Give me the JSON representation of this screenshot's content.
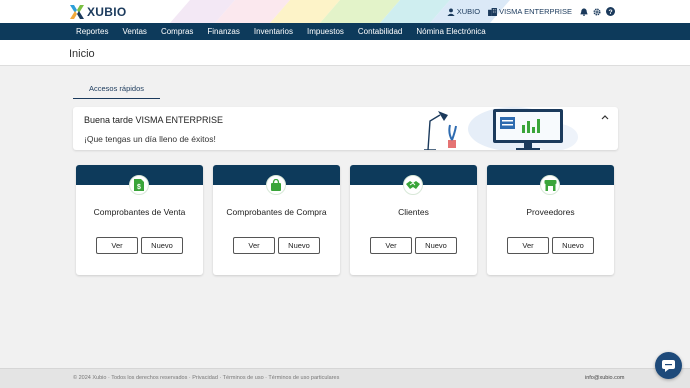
{
  "header": {
    "logo_text": "XUBIO",
    "user_label": "XUBIO",
    "company_label": "VISMA ENTERPRISE",
    "icons": [
      "user-icon",
      "building-icon",
      "bell-icon",
      "gear-icon",
      "help-icon"
    ]
  },
  "nav": {
    "items": [
      "Reportes",
      "Ventas",
      "Compras",
      "Finanzas",
      "Inventarios",
      "Impuestos",
      "Contabilidad",
      "Nómina Electrónica"
    ]
  },
  "page": {
    "title": "Inicio"
  },
  "tabs": {
    "active": "Accesos rápidos"
  },
  "greeting": {
    "title": "Buena tarde VISMA ENTERPRISE",
    "subtitle": "¡Que tengas un día lleno de éxitos!"
  },
  "cards": [
    {
      "title": "Comprobantes de Venta",
      "icon": "invoice-dollar-icon",
      "view_label": "Ver",
      "new_label": "Nuevo"
    },
    {
      "title": "Comprobantes de Compra",
      "icon": "shopping-bag-icon",
      "view_label": "Ver",
      "new_label": "Nuevo"
    },
    {
      "title": "Clientes",
      "icon": "handshake-icon",
      "view_label": "Ver",
      "new_label": "Nuevo"
    },
    {
      "title": "Proveedores",
      "icon": "store-icon",
      "view_label": "Ver",
      "new_label": "Nuevo"
    }
  ],
  "footer": {
    "left": "© 2024 Xubio · Todos los derechos reservados · Privacidad · Términos de uso · Términos de uso particulares",
    "right": "info@xubio.com"
  },
  "colors": {
    "brand_dark": "#0d3a5b",
    "accent_green": "#3aa53a"
  }
}
